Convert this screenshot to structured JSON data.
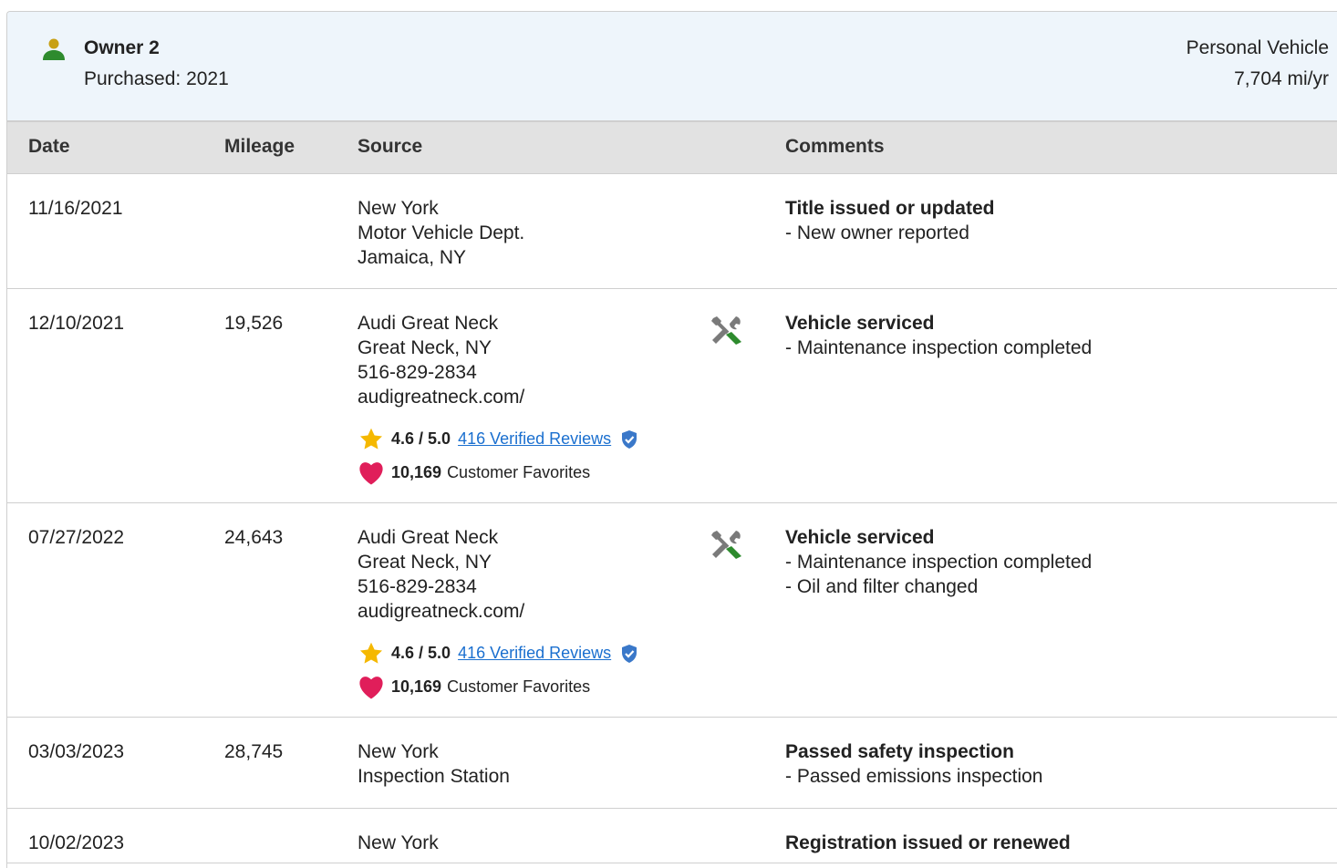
{
  "owner": {
    "name": "Owner 2",
    "purchased": "Purchased: 2021",
    "vehicle_type": "Personal Vehicle",
    "annual_miles": "7,704 mi/yr",
    "icon": "person-icon"
  },
  "columns": {
    "date": "Date",
    "mileage": "Mileage",
    "source": "Source",
    "comments": "Comments"
  },
  "records": [
    {
      "date": "11/16/2021",
      "mileage": "",
      "source": [
        "New York",
        "Motor Vehicle Dept.",
        "Jamaica, NY"
      ],
      "comment_title": "Title issued or updated",
      "comment_items": [
        "- New owner reported"
      ]
    },
    {
      "date": "12/10/2021",
      "mileage": "19,526",
      "source": [
        "Audi Great Neck",
        "Great Neck, NY",
        "516-829-2834",
        "audigreatneck.com/"
      ],
      "service_icon": "wrench-screwdriver-icon",
      "rating": "4.6 / 5.0",
      "reviews_link": "416 Verified Reviews",
      "favorites_count": "10,169",
      "favorites_label": "Customer Favorites",
      "comment_title": "Vehicle serviced",
      "comment_items": [
        "- Maintenance inspection completed"
      ]
    },
    {
      "date": "07/27/2022",
      "mileage": "24,643",
      "source": [
        "Audi Great Neck",
        "Great Neck, NY",
        "516-829-2834",
        "audigreatneck.com/"
      ],
      "service_icon": "wrench-screwdriver-icon",
      "rating": "4.6 / 5.0",
      "reviews_link": "416 Verified Reviews",
      "favorites_count": "10,169",
      "favorites_label": "Customer Favorites",
      "comment_title": "Vehicle serviced",
      "comment_items": [
        "- Maintenance inspection completed",
        "- Oil and filter changed"
      ]
    },
    {
      "date": "03/03/2023",
      "mileage": "28,745",
      "source": [
        "New York",
        "Inspection Station"
      ],
      "comment_title": "Passed safety inspection",
      "comment_items": [
        "- Passed emissions inspection"
      ]
    },
    {
      "date": "10/02/2023",
      "mileage": "",
      "source": [
        "New York"
      ],
      "comment_title": "Registration issued or renewed",
      "comment_items": []
    }
  ],
  "colors": {
    "header_bg": "#eef5fb",
    "table_head_bg": "#e2e2e2",
    "link": "#1a6fcf",
    "star": "#f5b800",
    "heart": "#e01e5a",
    "verified": "#3a78c9",
    "wrench_green": "#2e8b2e",
    "person_green": "#2e8b2e",
    "person_gold": "#c8a015"
  }
}
